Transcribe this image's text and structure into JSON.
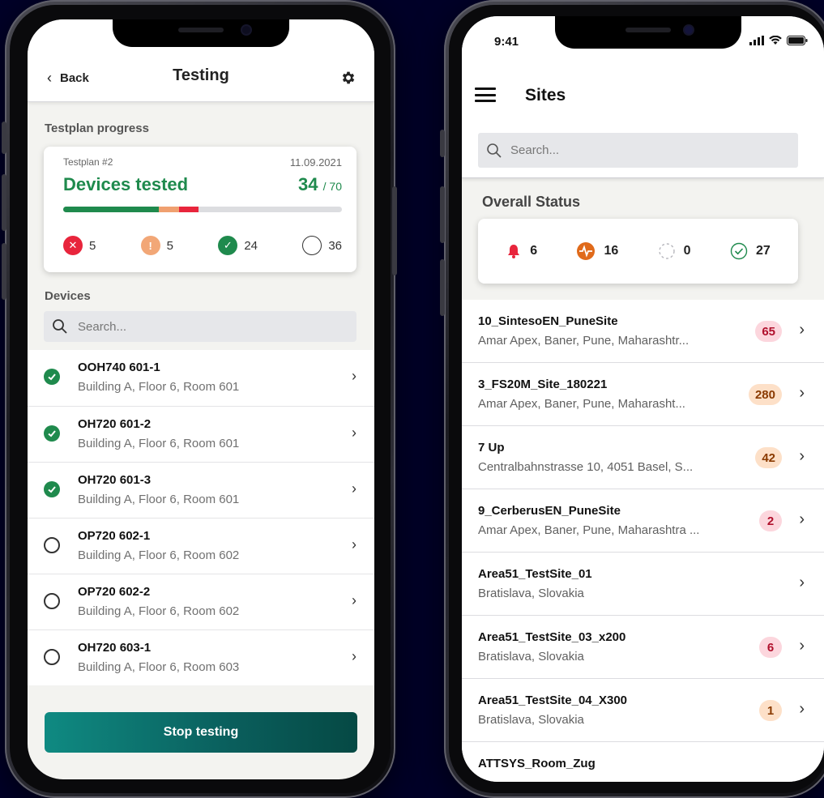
{
  "left_screen": {
    "header": {
      "back_label": "Back",
      "title": "Testing"
    },
    "testplan_section_label": "Testplan progress",
    "testplan": {
      "name": "Testplan #2",
      "date": "11.09.2021",
      "headline": "Devices tested",
      "tested": "34",
      "total": "/ 70",
      "progress": {
        "tested_ok": 24,
        "warning": 5,
        "failed": 5,
        "total": 70
      },
      "colors": {
        "ok": "#1f8a4d",
        "warning": "#f0a070",
        "failed": "#e8253c",
        "track": "#dcdde0"
      },
      "stats": {
        "failed": "5",
        "warning": "5",
        "passed": "24",
        "untested": "36"
      }
    },
    "devices_section_label": "Devices",
    "device_search": {
      "placeholder": "Search..."
    },
    "devices": [
      {
        "name": "OOH740 601-1",
        "location": "Building A, Floor 6, Room 601",
        "status": "ok"
      },
      {
        "name": "OH720 601-2",
        "location": "Building A, Floor 6, Room 601",
        "status": "ok"
      },
      {
        "name": "OH720 601-3",
        "location": "Building A, Floor 6, Room 601",
        "status": "ok"
      },
      {
        "name": "OP720 602-1",
        "location": "Building A, Floor 6, Room 602",
        "status": "empty"
      },
      {
        "name": "OP720 602-2",
        "location": "Building A, Floor 6, Room 602",
        "status": "empty"
      },
      {
        "name": "OH720 603-1",
        "location": "Building A, Floor 6, Room 603",
        "status": "empty"
      }
    ],
    "stop_button_label": "Stop testing"
  },
  "right_screen": {
    "status_bar": {
      "time": "9:41"
    },
    "header": {
      "title": "Sites"
    },
    "site_search": {
      "placeholder": "Search..."
    },
    "overall_label": "Overall Status",
    "overall": {
      "alarms": "6",
      "faults": "16",
      "offline": "0",
      "ok": "27"
    },
    "sites": [
      {
        "name": "10_SintesoEN_PuneSite",
        "address": "Amar Apex, Baner, Pune, Maharashtr...",
        "badge": "65",
        "badge_style": "pink"
      },
      {
        "name": "3_FS20M_Site_180221",
        "address": "Amar Apex, Baner, Pune, Maharasht...",
        "badge": "280",
        "badge_style": "peach"
      },
      {
        "name": "7 Up",
        "address": "Centralbahnstrasse 10, 4051 Basel, S...",
        "badge": "42",
        "badge_style": "peach"
      },
      {
        "name": "9_CerberusEN_PuneSite",
        "address": "Amar Apex, Baner, Pune, Maharashtra ...",
        "badge": "2",
        "badge_style": "pink"
      },
      {
        "name": "Area51_TestSite_01",
        "address": "Bratislava, Slovakia",
        "badge": "",
        "badge_style": ""
      },
      {
        "name": "Area51_TestSite_03_x200",
        "address": "Bratislava, Slovakia",
        "badge": "6",
        "badge_style": "pink"
      },
      {
        "name": "Area51_TestSite_04_X300",
        "address": "Bratislava, Slovakia",
        "badge": "1",
        "badge_style": "peach"
      },
      {
        "name": "ATTSYS_Room_Zug",
        "address": "",
        "badge": "",
        "badge_style": ""
      }
    ]
  }
}
